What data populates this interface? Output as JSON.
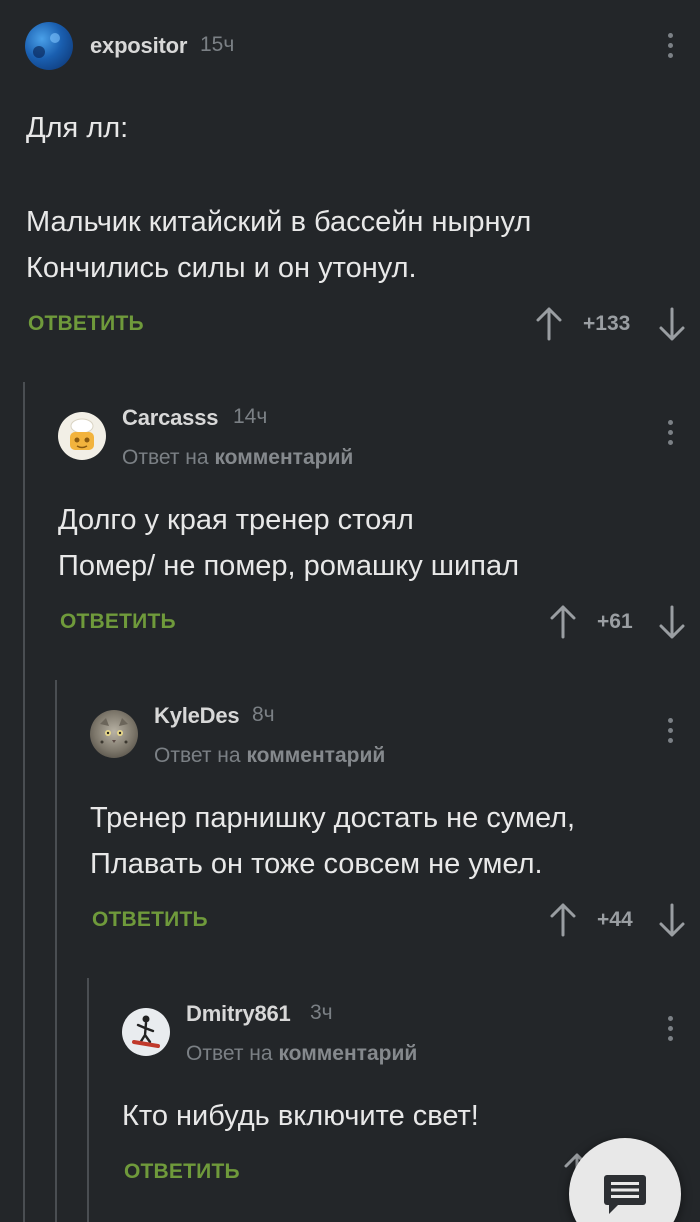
{
  "comments": [
    {
      "username": "expositor",
      "time": "15ч",
      "lines": [
        "Для лл:",
        "",
        "Мальчик китайский в бассейн нырнул",
        "Кончились силы и он утонул."
      ],
      "reply_label": "ОТВЕТИТЬ",
      "rating": "+133"
    },
    {
      "username": "Carcasss",
      "time": "14ч",
      "reply_prefix": "Ответ на",
      "reply_target": "комментарий",
      "lines": [
        "Долго у края тренер стоял",
        "Помер/ не помер,  ромашку шипал"
      ],
      "reply_label": "ОТВЕТИТЬ",
      "rating": "+61"
    },
    {
      "username": "KyleDes",
      "time": "8ч",
      "reply_prefix": "Ответ на",
      "reply_target": "комментарий",
      "lines": [
        "Тренер парнишку достать не сумел,",
        "Плавать он тоже совсем не умел."
      ],
      "reply_label": "ОТВЕТИТЬ",
      "rating": "+44"
    },
    {
      "username": "Dmitry861",
      "time": "3ч",
      "reply_prefix": "Ответ на",
      "reply_target": "комментарий",
      "lines": [
        "Кто нибудь включите свет!"
      ],
      "reply_label": "ОТВЕТИТЬ"
    }
  ],
  "icons": {
    "upvote": "arrow-up-icon",
    "downvote": "arrow-down-icon",
    "more": "more-vertical-icon",
    "fab": "comments-icon"
  },
  "colors": {
    "background": "#232629",
    "accent_reply": "#6f9a3b",
    "thread_line": "#4a4e52"
  }
}
